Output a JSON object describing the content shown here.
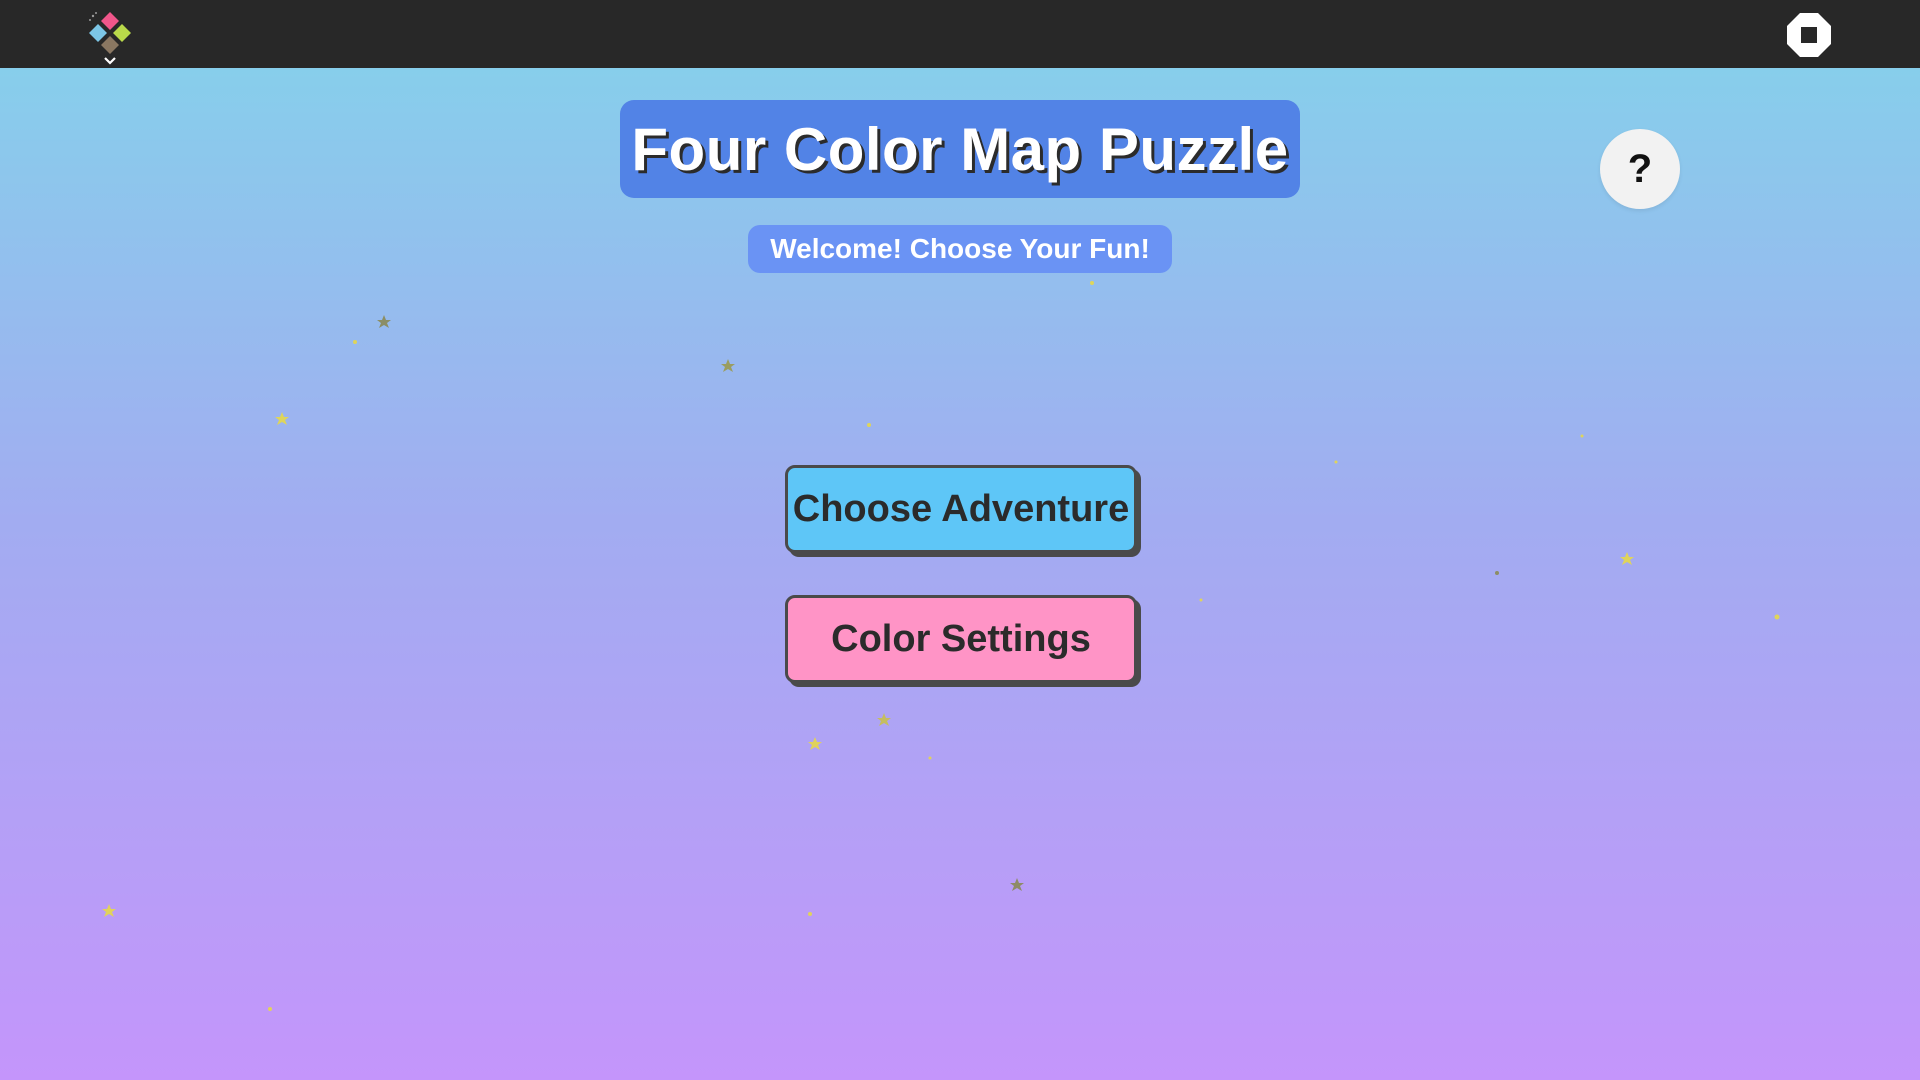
{
  "toolbar": {
    "activity_icon": "activity-color-diamonds-icon",
    "stop_icon": "stop-icon"
  },
  "game": {
    "title": "Four Color Map Puzzle",
    "subtitle": "Welcome! Choose Your Fun!",
    "help_label": "?",
    "buttons": {
      "adventure_label": "Choose Adventure",
      "settings_label": "Color Settings"
    },
    "decorations": "sparkle-star-icons"
  },
  "colors": {
    "title_bg": "#5283e6",
    "subtitle_bg": "#6a93f4",
    "adventure_bg": "#5ec6f7",
    "settings_bg": "#ff94c6",
    "toolbar_bg": "#282828",
    "gradient_top": "#87ceeb",
    "gradient_bottom": "#c495fb",
    "sparkle": "#e6d84a"
  }
}
